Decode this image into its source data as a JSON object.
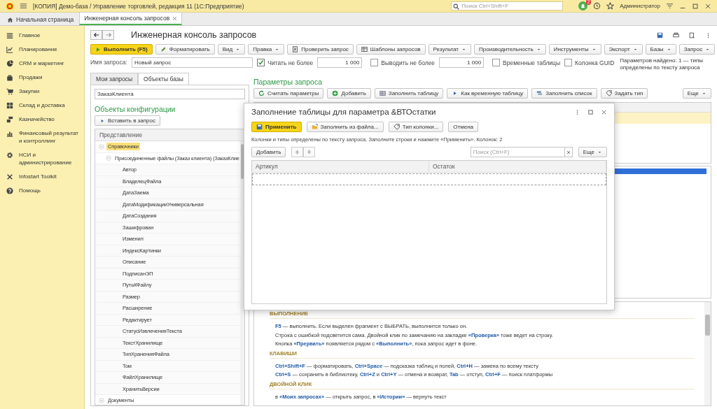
{
  "window": {
    "title": "[КОПИЯ] Демо-база / Управление торговлей, редакция 11  (1С:Предприятие)",
    "search": {
      "placeholder": "Поиск Ctrl+Shift+F"
    },
    "notifications": "2",
    "user": "Администратор"
  },
  "tabs": [
    {
      "label": "Начальная страница",
      "kind": "home",
      "selected": false
    },
    {
      "label": "Инженерная консоль запросов",
      "kind": "closable",
      "selected": true
    }
  ],
  "sidebar": {
    "items": [
      {
        "label": "Главное"
      },
      {
        "label": "Планирование"
      },
      {
        "label": "CRM и маркетинг"
      },
      {
        "label": "Продажи"
      },
      {
        "label": "Закупки"
      },
      {
        "label": "Склад и доставка"
      },
      {
        "label": "Казначейство"
      },
      {
        "label": "Финансовый результат и контроллинг"
      },
      {
        "label": "НСИ и администрирование"
      },
      {
        "label": "Infostart Toolkit"
      },
      {
        "label": "Помощь"
      }
    ]
  },
  "form": {
    "title": "Инженерная консоль запросов",
    "toolbar": [
      {
        "label": "Выполнить (F5)",
        "kind": "primary"
      },
      {
        "label": "Форматировать",
        "kind": "icon"
      },
      {
        "label": "Вид",
        "kind": "dropdown"
      },
      {
        "label": "Правка",
        "kind": "dropdown"
      },
      {
        "label": "Проверить запрос",
        "kind": "icon"
      },
      {
        "label": "Шаблоны запросов",
        "kind": "icon"
      },
      {
        "label": "Результат",
        "kind": "dropdown"
      },
      {
        "label": "Производительность",
        "kind": "dropdown"
      },
      {
        "label": "Инструменты",
        "kind": "dropdown"
      },
      {
        "label": "Экспорт",
        "kind": "dropdown"
      },
      {
        "label": "Базы",
        "kind": "dropdown"
      },
      {
        "label": "Запрос",
        "kind": "dropdown"
      }
    ],
    "query_name": {
      "label": "Имя запроса:",
      "value": "Новый запрос"
    },
    "options": [
      {
        "kind": "checkbox",
        "label": "Читать не более",
        "checked": true
      },
      {
        "kind": "number",
        "value": "1 000"
      },
      {
        "kind": "checkbox",
        "label": "Выводить не более",
        "checked": false
      },
      {
        "kind": "number",
        "value": "1 000"
      },
      {
        "kind": "checkbox",
        "label": "Временные таблицы",
        "checked": false
      },
      {
        "kind": "checkbox",
        "label": "Колонка GUID",
        "checked": false
      }
    ],
    "params_info": "Параметров найдено: 1 — типы определены по тексту запроса"
  },
  "left_panel": {
    "tabs": [
      {
        "label": "Мои запросы",
        "selected": false
      },
      {
        "label": "Объекты базы",
        "selected": true
      }
    ],
    "search": {
      "value": "ЗаказКлиента"
    },
    "heading": "Объекты конфигурации",
    "insert_button": "Вставить в запрос",
    "tree": {
      "header": "Представление",
      "items": [
        {
          "label": "Справочники",
          "expanded": true,
          "selected": true,
          "children": [
            {
              "label": "Присоединенные файлы (Заказ клиента) (ЗаказКлие",
              "expanded": true,
              "selected": false,
              "children": [
                {
                  "label": "Автор",
                  "selected": false
                },
                {
                  "label": "ВладелецФайла",
                  "selected": false
                },
                {
                  "label": "ДатаЗаема",
                  "selected": false
                },
                {
                  "label": "ДатаМодификацииУниверсальная",
                  "selected": false
                },
                {
                  "label": "ДатаСоздания",
                  "selected": false
                },
                {
                  "label": "Зашифрован",
                  "selected": false
                },
                {
                  "label": "Изменил",
                  "selected": false
                },
                {
                  "label": "ИндексКартинки",
                  "selected": false
                },
                {
                  "label": "Описание",
                  "selected": false
                },
                {
                  "label": "ПодписанЭП",
                  "selected": false
                },
                {
                  "label": "ПутьКФайлу",
                  "selected": false
                },
                {
                  "label": "Размер",
                  "selected": false
                },
                {
                  "label": "Расширение",
                  "selected": false
                },
                {
                  "label": "Редактирует",
                  "selected": false
                },
                {
                  "label": "СтатусИзвлеченияТекста",
                  "selected": false
                },
                {
                  "label": "ТекстХранилище",
                  "selected": false
                },
                {
                  "label": "ТипХраненияФайла",
                  "selected": false
                },
                {
                  "label": "Том",
                  "selected": false
                },
                {
                  "label": "ФайлХранилище",
                  "selected": false
                },
                {
                  "label": "ХранитьВерсии",
                  "selected": false
                }
              ]
            }
          ]
        },
        {
          "label": "Документы",
          "expanded": true,
          "selected": false
        }
      ]
    }
  },
  "params": {
    "heading": "Параметры запроса",
    "buttons": [
      {
        "label": "Считать параметры"
      },
      {
        "label": "Добавить"
      },
      {
        "label": "Заполнить таблицу"
      },
      {
        "label": "Как временную таблицу"
      },
      {
        "label": "Заполнить список"
      },
      {
        "label": "Задать тип"
      }
    ],
    "more": "Еще",
    "rows": [
      {
        "selected": true
      }
    ]
  },
  "editor": {
    "lines": [
      {
        "selected": true
      }
    ]
  },
  "help": {
    "sections": [
      {
        "heading": "ВЫПОЛНЕНИЕ",
        "lines": [
          "**F5** — выполнить. Если выделен фрагмент с ВЫБРАТЬ, выполнится только он.",
          "Строка с ошибкой подсветится сама. Двойной клик по замечанию на закладке **«Проверка»** тоже ведет на строку.",
          "Кнопка **«Прервать»** появляется рядом с **«Выполнить»**, пока запрос идет в фоне."
        ]
      },
      {
        "heading": "КЛАВИШИ",
        "lines": [
          "**Ctrl+Shift+F** — форматировать, **Ctrl+Space** — подсказка таблиц и полей, **Ctrl+H** — замена по всему тексту",
          "**Ctrl+S** — сохранить в библиотеку, **Ctrl+Z** и **Ctrl+Y** — отмена и возврат, **Tab** — отступ, **Ctrl+F** — поиск платформы"
        ]
      },
      {
        "heading": "ДВОЙНОЙ КЛИК",
        "lines": [
          "в **«Моих запросах»** — открыть запрос, в **«Истории»** — вернуть текст"
        ]
      }
    ]
  },
  "dialog": {
    "title": "Заполнение таблицы для параметра &ВТОстатки",
    "buttons": [
      {
        "label": "Применить",
        "kind": "primary"
      },
      {
        "label": "Заполнить из файла...",
        "kind": "icon"
      },
      {
        "label": "Тип колонки...",
        "kind": "icon"
      },
      {
        "label": "Отмена",
        "kind": "plain"
      }
    ],
    "info": "Колонки и типы определены по тексту запроса. Заполните строки и нажмите «Применить». Колонок: 2",
    "add_button": "Добавить",
    "move_disabled": true,
    "search": {
      "placeholder": "Поиск (Ctrl+F)"
    },
    "more": "Еще",
    "columns": [
      "Артикул",
      "Остаток"
    ],
    "new_row": true
  }
}
